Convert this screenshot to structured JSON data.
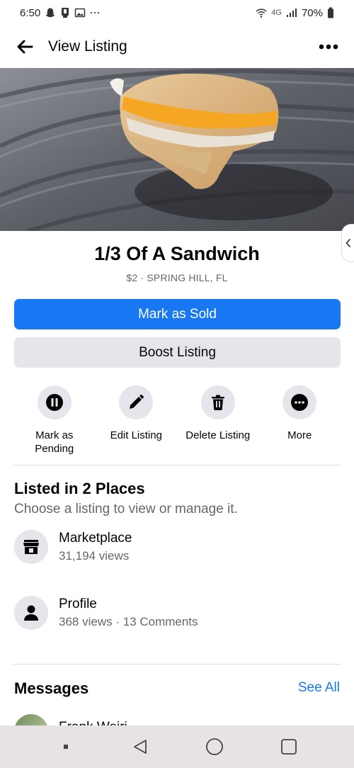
{
  "status_bar": {
    "time": "6:50",
    "network": "4G",
    "battery": "70%",
    "icons": [
      "snapchat-icon",
      "notification-icon",
      "gallery-icon",
      "more-dots-icon",
      "wifi-icon",
      "signal-icon",
      "battery-icon"
    ]
  },
  "app_bar": {
    "title": "View Listing",
    "back_icon": "arrow-left-icon",
    "more_icon": "more-horizontal-icon"
  },
  "listing": {
    "title": "1/3 Of A Sandwich",
    "subtitle": "$2 · SPRING HILL, FL"
  },
  "buttons": {
    "primary": "Mark as Sold",
    "secondary": "Boost Listing"
  },
  "actions": [
    {
      "label": "Mark as Pending",
      "icon": "pause-icon"
    },
    {
      "label": "Edit Listing",
      "icon": "pencil-icon"
    },
    {
      "label": "Delete Listing",
      "icon": "trash-icon"
    },
    {
      "label": "More",
      "icon": "more-dots-icon"
    }
  ],
  "places": {
    "title": "Listed in 2 Places",
    "description": "Choose a listing to view or manage it.",
    "items": [
      {
        "name": "Marketplace",
        "meta": "31,194 views",
        "icon": "storefront-icon"
      },
      {
        "name": "Profile",
        "meta": "368 views · 13 Comments",
        "icon": "person-icon"
      }
    ]
  },
  "messages": {
    "title": "Messages",
    "see_all": "See All",
    "items": [
      {
        "name": "Frank Weiri"
      }
    ]
  },
  "colors": {
    "accent": "#1877f2",
    "secondary_button": "#e4e6eb",
    "muted_text": "#65676b",
    "text": "#050505",
    "nav_bar": "#e8e2e6"
  }
}
